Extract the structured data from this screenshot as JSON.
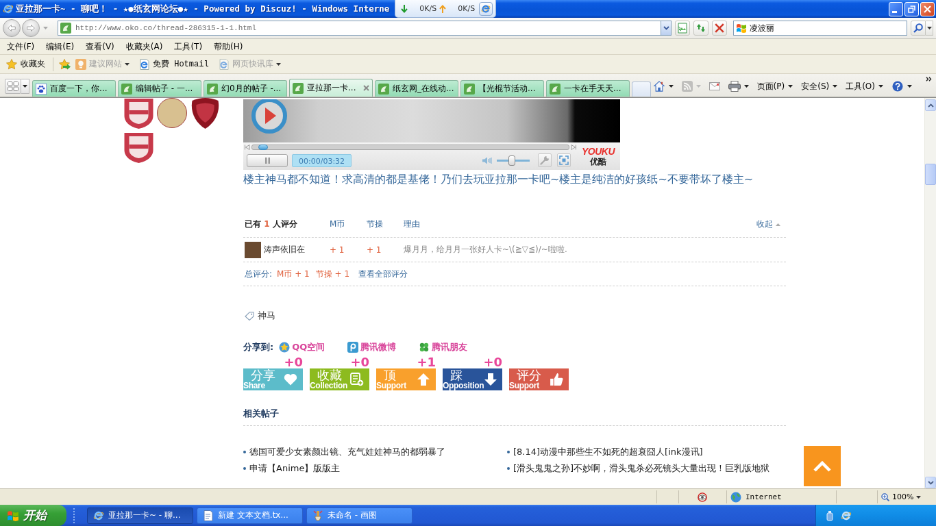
{
  "window": {
    "title": "亚拉那一卡~ - 聊吧！ - ★●纸玄网论坛●★ - Powered by Discuz! - Windows Interne"
  },
  "speed_meter": {
    "download": "0K/S",
    "upload": "0K/S"
  },
  "address_bar": {
    "url": "http://www.oko.co/thread-286315-1-1.html",
    "search": "凌波丽"
  },
  "menu_bar": [
    "文件(F)",
    "编辑(E)",
    "查看(V)",
    "收藏夹(A)",
    "工具(T)",
    "帮助(H)"
  ],
  "favorites_bar": {
    "label": "收藏夹",
    "items": [
      {
        "kind": "suggested",
        "label": "建议网站",
        "disabled": true,
        "dropdown": true
      },
      {
        "kind": "browser",
        "label": "免费 Hotmail",
        "disabled": false,
        "dropdown": false
      },
      {
        "kind": "browser",
        "label": "网页快讯库",
        "disabled": true,
        "dropdown": true
      }
    ]
  },
  "tabs": [
    {
      "kind": "baidu",
      "label": "百度一下，你...",
      "selected": false
    },
    {
      "kind": "site",
      "label": "编辑帖子 - 一...",
      "selected": false
    },
    {
      "kind": "site",
      "label": "幻0月的帖子 -...",
      "selected": false
    },
    {
      "kind": "site",
      "label": "亚拉那一卡...",
      "selected": true
    },
    {
      "kind": "site",
      "label": "纸玄网_在线动...",
      "selected": false
    },
    {
      "kind": "site",
      "label": "【光棍节活动...",
      "selected": false
    },
    {
      "kind": "site",
      "label": "一卡在手天天...",
      "selected": false
    }
  ],
  "command_bar": [
    {
      "kind": "home",
      "dropdown": true,
      "disabled": false
    },
    {
      "kind": "feeds",
      "dropdown": true,
      "disabled": true
    },
    {
      "kind": "mail",
      "dropdown": false,
      "disabled": false
    },
    {
      "kind": "print",
      "dropdown": true,
      "disabled": false
    },
    {
      "kind": "menu",
      "label": "页面(P)",
      "dropdown": true,
      "disabled": false
    },
    {
      "kind": "menu",
      "label": "安全(S)",
      "dropdown": true,
      "disabled": false
    },
    {
      "kind": "menu",
      "label": "工具(O)",
      "dropdown": true,
      "disabled": false
    },
    {
      "kind": "help",
      "dropdown": true,
      "disabled": false
    }
  ],
  "post": {
    "video": {
      "progress": {
        "level": 0.02
      },
      "time": "00:00/03:32",
      "volume": {
        "level": 0.45
      },
      "logo": "YOUKU",
      "logo_cn": "优酷"
    },
    "text": "楼主神马都不知道！求高清的都是基佬！乃们去玩亚拉那一卡吧~楼主是纯洁的好孩纸~不要带坏了楼主~",
    "rating": {
      "summary_before": "已有",
      "count": "1",
      "summary_after": "人评分",
      "columns": [
        "M币",
        "节操",
        "理由"
      ],
      "collapse": "收起",
      "rows": [
        {
          "user": "涛声依旧在",
          "values": [
            "+ 1",
            "+ 1"
          ],
          "reason": "爆月月，给月月一张好人卡~\\(≧▽≦)/~啦啦."
        }
      ],
      "total_label": "总评分:",
      "totals": [
        "M币 + 1",
        "节操 + 1"
      ],
      "view_all": "查看全部评分"
    },
    "tags": [
      "神马"
    ],
    "share": {
      "label": "分享到:",
      "targets": [
        {
          "kind": "qzone",
          "label": "QQ空间"
        },
        {
          "kind": "weibo",
          "label": "腾讯微博"
        },
        {
          "kind": "pengyou",
          "label": "腾讯朋友"
        }
      ]
    },
    "actions": [
      {
        "kind": "share",
        "label": "分享",
        "label_en": "Share",
        "count": "+0",
        "color": "#5cbcca"
      },
      {
        "kind": "collect",
        "label": "收藏",
        "label_en": "Collection",
        "count": "+0",
        "color": "#8dbb1f"
      },
      {
        "kind": "up",
        "label": "顶",
        "label_en": "Support",
        "count": "+1",
        "color": "#f9a02c"
      },
      {
        "kind": "down",
        "label": "踩",
        "label_en": "Opposition",
        "count": "+0",
        "color": "#29549a"
      },
      {
        "kind": "rate",
        "label": "评分",
        "label_en": "Support",
        "color": "#d85b4b"
      }
    ],
    "related": {
      "title": "相关帖子",
      "items": [
        "德国可爱少女素颜出镜、充气娃娃神马的都弱暴了",
        "[8.14]动漫中那些生不如死的超衰囧人[ink漫讯]",
        "申请【Anime】版版主",
        "[滑头鬼鬼之孙]不妙啊，滑头鬼杀必死镜头大量出现！巨乳版地狱"
      ]
    }
  },
  "status_bar": {
    "zone": "Internet",
    "zoom": "100%"
  },
  "taskbar": {
    "start": "开始",
    "tasks": [
      {
        "kind": "browser",
        "label": "亚拉那一卡~ - 聊...",
        "selected": true
      },
      {
        "kind": "notepad",
        "label": "新建 文本文档.tx...",
        "selected": false
      },
      {
        "kind": "paint",
        "label": "未命名 - 画图",
        "selected": false
      }
    ]
  }
}
